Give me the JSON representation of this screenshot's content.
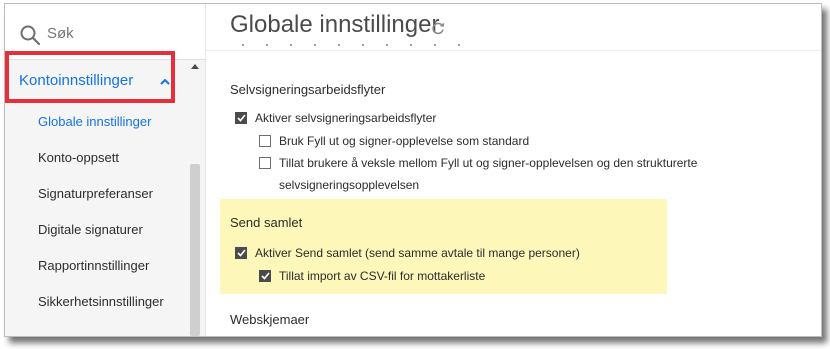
{
  "search": {
    "placeholder": "Søk"
  },
  "sidebar": {
    "group_label": "Kontoinnstillinger",
    "items": [
      {
        "label": "Globale innstillinger",
        "active": true
      },
      {
        "label": "Konto-oppsett",
        "active": false
      },
      {
        "label": "Signaturpreferanser",
        "active": false
      },
      {
        "label": "Digitale signaturer",
        "active": false
      },
      {
        "label": "Rapportinnstillinger",
        "active": false
      },
      {
        "label": "Sikkerhetsinnstillinger",
        "active": false
      }
    ]
  },
  "header": {
    "title": "Globale innstillinger"
  },
  "sections": {
    "self_sign": {
      "title": "Selvsigneringsarbeidsflyter",
      "options": [
        {
          "label": "Aktiver selvsigneringsarbeidsflyter",
          "checked": true
        },
        {
          "label": "Bruk Fyll ut og signer-opplevelse som standard",
          "checked": false
        },
        {
          "label_line1": "Tillat brukere å veksle mellom Fyll ut og signer-opplevelsen og den strukturerte",
          "label_line2": "selvsigneringsopplevelsen",
          "checked": false
        }
      ]
    },
    "send_in_bulk": {
      "title": "Send samlet",
      "options": [
        {
          "label": "Aktiver Send samlet (send samme avtale til mange personer)",
          "checked": true
        },
        {
          "label": "Tillat import av CSV-fil for mottakerliste",
          "checked": true
        }
      ]
    },
    "web_forms": {
      "title": "Webskjemaer"
    }
  },
  "colors": {
    "accent": "#1473e6",
    "highlight_border": "#e5303b",
    "callout_bg": "#fdf7b9"
  },
  "icons": {
    "search": "search-icon",
    "refresh": "refresh-icon",
    "chevron": "chevron-up-icon",
    "checkbox": "checkmark-icon"
  }
}
